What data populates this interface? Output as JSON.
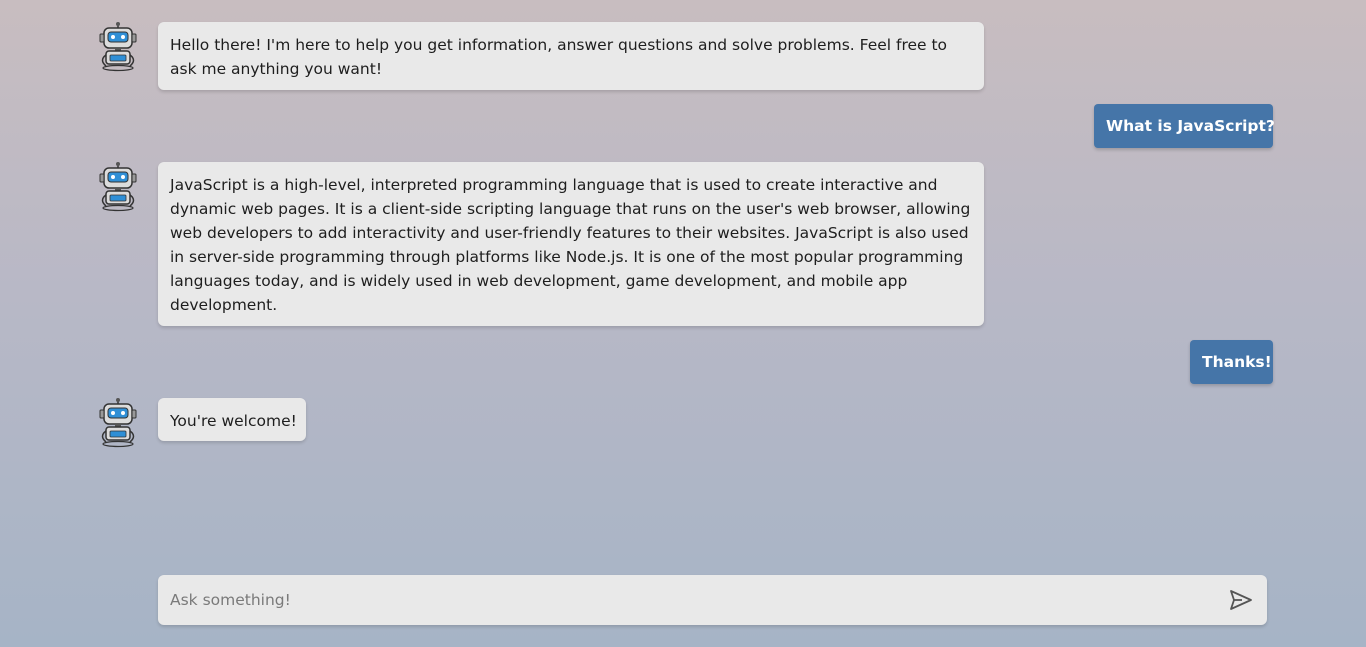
{
  "messages": [
    {
      "role": "bot",
      "text": "Hello there! I'm here to help you get information, answer questions and solve problems. Feel free to ask me anything you want!"
    },
    {
      "role": "user",
      "text": "What is JavaScript?"
    },
    {
      "role": "bot",
      "text": "JavaScript is a high-level, interpreted programming language that is used to create interactive and dynamic web pages. It is a client-side scripting language that runs on the user's web browser, allowing web developers to add interactivity and user-friendly features to their websites. JavaScript is also used in server-side programming through platforms like Node.js. It is one of the most popular programming languages today, and is widely used in web development, game development, and mobile app development."
    },
    {
      "role": "user",
      "text": "Thanks!"
    },
    {
      "role": "bot",
      "text": "You're welcome!"
    }
  ],
  "input": {
    "value": "",
    "placeholder": "Ask something!"
  },
  "icons": {
    "bot_avatar": "robot-icon",
    "send": "send-icon"
  },
  "colors": {
    "user_bubble": "#4575a8",
    "bot_bubble": "#e9e9e9",
    "bot_accent": "#2f8fd6"
  }
}
